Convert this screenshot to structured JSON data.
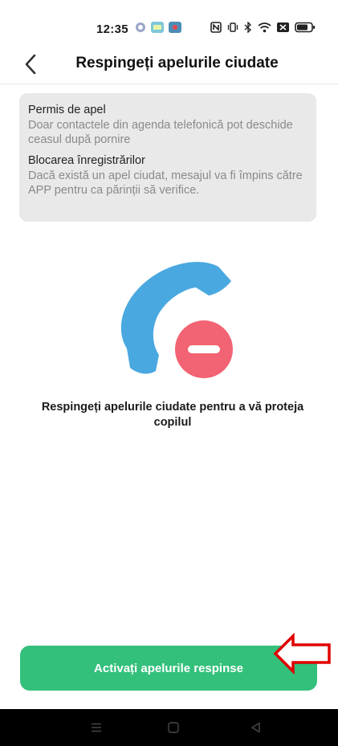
{
  "status_bar": {
    "time": "12:35"
  },
  "header": {
    "title": "Respingeți apelurile ciudate",
    "back_icon": "chevron-left-icon"
  },
  "info_card": {
    "items": [
      {
        "title": "Permis de apel",
        "description": "Doar contactele din agenda telefonică pot deschide ceasul după pornire"
      },
      {
        "title": "Blocarea înregistrărilor",
        "description": "Dacă există un apel ciudat, mesajul va fi împins către APP pentru ca părinții să verifice."
      }
    ]
  },
  "main": {
    "illustration_icon": "reject-call-icon",
    "subtitle": "Respingeți apelurile ciudate pentru a vă proteja copilul"
  },
  "footer": {
    "button_label": "Activați apelurile respinse"
  },
  "colors": {
    "accent": "#33c07b",
    "phone": "#4aa8e0",
    "reject": "#f26373",
    "annotation": "#e00000"
  }
}
